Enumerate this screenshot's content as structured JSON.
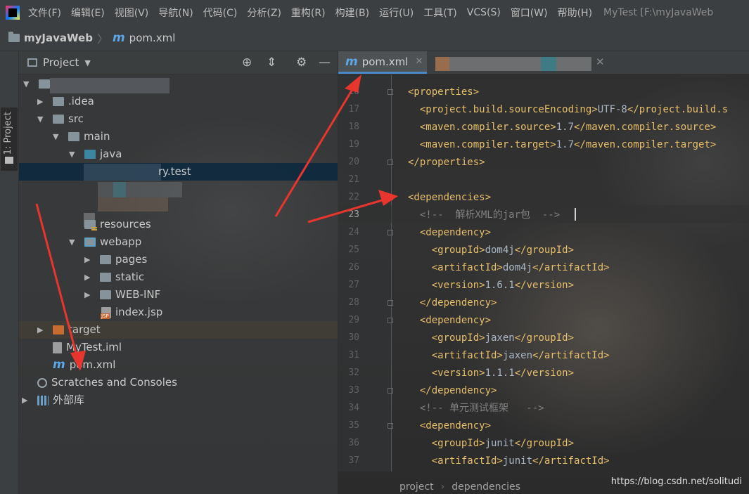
{
  "menu": {
    "items": [
      "文件(F)",
      "编辑(E)",
      "视图(V)",
      "导航(N)",
      "代码(C)",
      "分析(Z)",
      "重构(R)",
      "构建(B)",
      "运行(U)",
      "工具(T)",
      "VCS(S)",
      "窗口(W)",
      "帮助(H)"
    ],
    "window_title": "MyTest [F:\\myJavaWeb"
  },
  "breadcrumb": {
    "project": "myJavaWeb",
    "file": "pom.xml"
  },
  "tool_stripe": {
    "label": "1: Project"
  },
  "project_panel": {
    "title": "Project",
    "tree": [
      {
        "label": ".idea",
        "indent": 1,
        "arrow": "▶",
        "icon": "grey"
      },
      {
        "label": "src",
        "indent": 1,
        "arrow": "▼",
        "icon": "grey"
      },
      {
        "label": "main",
        "indent": 2,
        "arrow": "▼",
        "icon": "grey"
      },
      {
        "label": "java",
        "indent": 3,
        "arrow": "▼",
        "icon": "blue"
      },
      {
        "label": "resources",
        "indent": 3,
        "arrow": "",
        "icon": "res"
      },
      {
        "label": "webapp",
        "indent": 3,
        "arrow": "▼",
        "icon": "webapp"
      },
      {
        "label": "pages",
        "indent": 4,
        "arrow": "▶",
        "icon": "grey"
      },
      {
        "label": "static",
        "indent": 4,
        "arrow": "▶",
        "icon": "grey"
      },
      {
        "label": "WEB-INF",
        "indent": 4,
        "arrow": "▶",
        "icon": "grey"
      },
      {
        "label": "index.jsp",
        "indent": 4,
        "arrow": "",
        "icon": "jsp"
      },
      {
        "label": "target",
        "indent": 1,
        "arrow": "▶",
        "icon": "orange"
      },
      {
        "label": "MyTest.iml",
        "indent": 1,
        "arrow": "",
        "icon": "iml"
      },
      {
        "label": "pom.xml",
        "indent": 1,
        "arrow": "",
        "icon": "maven"
      },
      {
        "label": "Scratches and Consoles",
        "indent": 0,
        "arrow": "",
        "icon": "scratch"
      },
      {
        "label": "外部库",
        "indent": 0,
        "arrow": "▶",
        "icon": "lib"
      }
    ],
    "partial_selected_text": "ry.test"
  },
  "editor": {
    "active_tab": "pom.xml",
    "line_numbers": [
      "16",
      "17",
      "18",
      "19",
      "20",
      "21",
      "22",
      "23",
      "24",
      "25",
      "26",
      "27",
      "28",
      "29",
      "30",
      "31",
      "32",
      "33",
      "34",
      "35",
      "36",
      "37"
    ],
    "current_line": "23",
    "code_lines": [
      [
        {
          "c": "tag",
          "t": "<properties>"
        }
      ],
      [
        {
          "c": "tag",
          "t": "  <project.build.sourceEncoding>"
        },
        {
          "c": "txt",
          "t": "UTF-8"
        },
        {
          "c": "tag",
          "t": "</project.build.s"
        }
      ],
      [
        {
          "c": "tag",
          "t": "  <maven.compiler.source>"
        },
        {
          "c": "txt",
          "t": "1.7"
        },
        {
          "c": "tag",
          "t": "</maven.compiler.source>"
        }
      ],
      [
        {
          "c": "tag",
          "t": "  <maven.compiler.target>"
        },
        {
          "c": "txt",
          "t": "1.7"
        },
        {
          "c": "tag",
          "t": "</maven.compiler.target>"
        }
      ],
      [
        {
          "c": "tag",
          "t": "</properties>"
        }
      ],
      [
        {
          "c": "txt",
          "t": ""
        }
      ],
      [
        {
          "c": "tag",
          "t": "<dependencies>"
        }
      ],
      [
        {
          "c": "cmt",
          "t": "  <!--  解析XML的jar包  -->"
        }
      ],
      [
        {
          "c": "tag",
          "t": "  <dependency>"
        }
      ],
      [
        {
          "c": "tag",
          "t": "    <groupId>"
        },
        {
          "c": "txt",
          "t": "dom4j"
        },
        {
          "c": "tag",
          "t": "</groupId>"
        }
      ],
      [
        {
          "c": "tag",
          "t": "    <artifactId>"
        },
        {
          "c": "txt",
          "t": "dom4j"
        },
        {
          "c": "tag",
          "t": "</artifactId>"
        }
      ],
      [
        {
          "c": "tag",
          "t": "    <version>"
        },
        {
          "c": "txt",
          "t": "1.6.1"
        },
        {
          "c": "tag",
          "t": "</version>"
        }
      ],
      [
        {
          "c": "tag",
          "t": "  </dependency>"
        }
      ],
      [
        {
          "c": "tag",
          "t": "  <dependency>"
        }
      ],
      [
        {
          "c": "tag",
          "t": "    <groupId>"
        },
        {
          "c": "txt",
          "t": "jaxen"
        },
        {
          "c": "tag",
          "t": "</groupId>"
        }
      ],
      [
        {
          "c": "tag",
          "t": "    <artifactId>"
        },
        {
          "c": "txt",
          "t": "jaxen"
        },
        {
          "c": "tag",
          "t": "</artifactId>"
        }
      ],
      [
        {
          "c": "tag",
          "t": "    <version>"
        },
        {
          "c": "txt",
          "t": "1.1.1"
        },
        {
          "c": "tag",
          "t": "</version>"
        }
      ],
      [
        {
          "c": "tag",
          "t": "  </dependency>"
        }
      ],
      [
        {
          "c": "cmt",
          "t": "  <!-- 单元测试框架   -->"
        }
      ],
      [
        {
          "c": "tag",
          "t": "  <dependency>"
        }
      ],
      [
        {
          "c": "tag",
          "t": "    <groupId>"
        },
        {
          "c": "txt",
          "t": "junit"
        },
        {
          "c": "tag",
          "t": "</groupId>"
        }
      ],
      [
        {
          "c": "tag",
          "t": "    <artifactId>"
        },
        {
          "c": "txt",
          "t": "junit"
        },
        {
          "c": "tag",
          "t": "</artifactId>"
        }
      ]
    ],
    "crumbs": [
      "project",
      "dependencies"
    ]
  },
  "watermark": "https://blog.csdn.net/solitudi",
  "colors": {
    "accent": "#4a88c7",
    "tag": "#e8bf6a",
    "text": "#a9b7c6",
    "comment": "#808080",
    "arrow": "#e8352e"
  },
  "icons": {
    "locate": "crosshair-icon",
    "collapse": "collapse-all-icon",
    "settings": "gear-icon",
    "hide": "minimize-icon"
  }
}
